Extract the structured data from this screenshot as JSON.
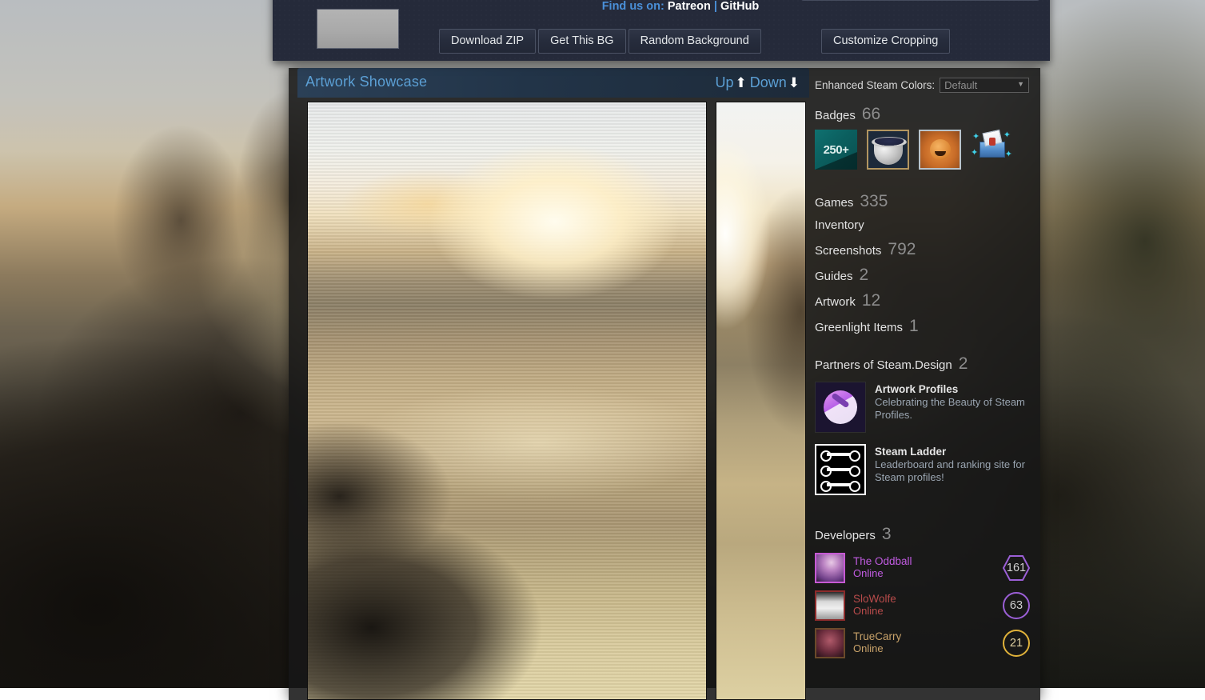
{
  "topbar": {
    "find_us_prefix": "Find us on:",
    "links": [
      "Patreon",
      "GitHub"
    ],
    "separator": "|",
    "buttons": [
      "Download ZIP",
      "Get This BG",
      "Random Background"
    ],
    "customize_button": "Customize Cropping",
    "thumbnail_name": "background-thumbnail",
    "progress_name": "background-preview-bar"
  },
  "showcase": {
    "title": "Artwork Showcase",
    "nav": {
      "up_label": "Up",
      "up_icon": "arrow-up-icon",
      "down_label": "Down",
      "down_icon": "arrow-down-icon"
    }
  },
  "sidebar": {
    "enhanced_colors": {
      "label": "Enhanced Steam Colors:",
      "selected": "Default",
      "caret_icon": "chevron-down-icon"
    },
    "badges": {
      "label": "Badges",
      "count": "66",
      "icons": [
        {
          "name": "badge-250-plus-icon",
          "text": "250+"
        },
        {
          "name": "badge-cauldron-icon",
          "text": ""
        },
        {
          "name": "badge-orange-face-icon",
          "text": ""
        },
        {
          "name": "badge-winter-gift-icon",
          "text": ""
        }
      ]
    },
    "stats": [
      {
        "label": "Games",
        "value": "335"
      },
      {
        "label": "Inventory",
        "value": ""
      },
      {
        "label": "Screenshots",
        "value": "792"
      },
      {
        "label": "Guides",
        "value": "2"
      },
      {
        "label": "Artwork",
        "value": "12"
      },
      {
        "label": "Greenlight Items",
        "value": "1"
      }
    ],
    "partners": {
      "label": "Partners of Steam.Design",
      "count": "2",
      "items": [
        {
          "name": "Artwork Profiles",
          "desc": "Celebrating the Beauty of Steam Profiles.",
          "logo": "artwork-profiles-logo"
        },
        {
          "name": "Steam Ladder",
          "desc": "Leaderboard and ranking site for Steam profiles!",
          "logo": "steam-ladder-logo"
        }
      ]
    },
    "developers": {
      "label": "Developers",
      "count": "3",
      "items": [
        {
          "name": "The Oddball",
          "status": "Online",
          "level": "161",
          "shape": "hexagon",
          "color": "#9b5fd6"
        },
        {
          "name": "SloWolfe",
          "status": "Online",
          "level": "63",
          "shape": "circle",
          "color": "#9b5fd6"
        },
        {
          "name": "TrueCarry",
          "status": "Online",
          "level": "21",
          "shape": "circle",
          "color": "#e0b23a"
        }
      ]
    }
  },
  "colors": {
    "accent_blue": "#5b9fd4",
    "link_blue": "#4a90d9",
    "panel_dark": "#252a3a",
    "profile_bg": "#171717",
    "stat_value": "#8d8d8d"
  }
}
